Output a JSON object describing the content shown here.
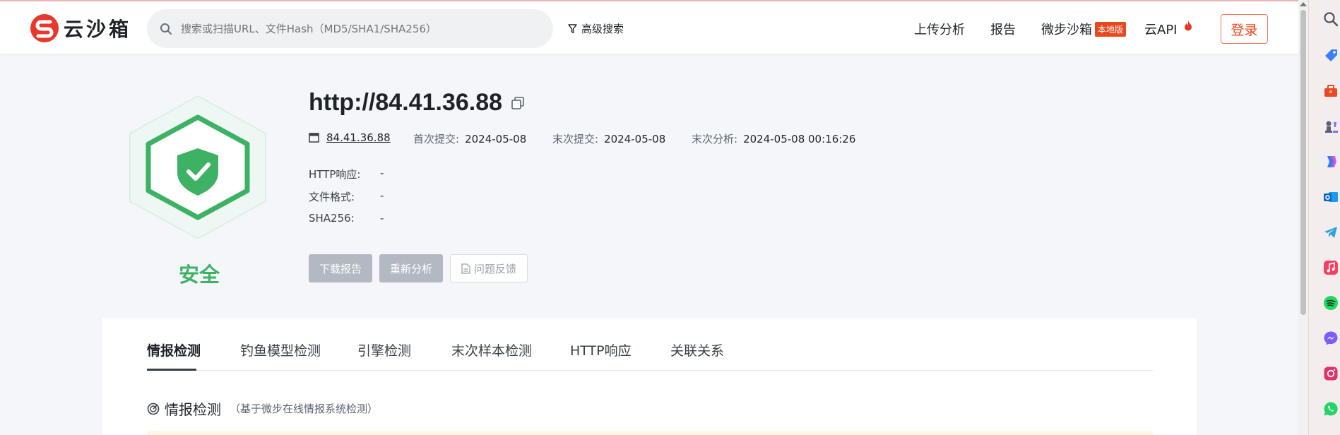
{
  "header": {
    "logo_text": "云沙箱",
    "search_placeholder": "搜索或扫描URL、文件Hash（MD5/SHA1/SHA256）",
    "advanced_search": "高级搜索",
    "nav": {
      "upload": "上传分析",
      "report": "报告",
      "sandbox": "微步沙箱",
      "sandbox_badge": "本地版",
      "api": "云API"
    },
    "login": "登录"
  },
  "result": {
    "verdict": "安全",
    "verdict_color": "#3db264",
    "title": "http://84.41.36.88",
    "host": "84.41.36.88",
    "first_submit_label": "首次提交:",
    "first_submit": "2024-05-08",
    "last_submit_label": "末次提交:",
    "last_submit": "2024-05-08",
    "last_analysis_label": "末次分析:",
    "last_analysis": "2024-05-08 00:16:26",
    "rows": [
      {
        "label": "HTTP响应:",
        "value": "-"
      },
      {
        "label": "文件格式:",
        "value": "-"
      },
      {
        "label": "SHA256:",
        "value": "-"
      }
    ],
    "buttons": {
      "download": "下载报告",
      "reanalyze": "重新分析",
      "feedback": "问题反馈"
    }
  },
  "tabs": [
    "情报检测",
    "钓鱼模型检测",
    "引擎检测",
    "末次样本检测",
    "HTTP响应",
    "关联关系"
  ],
  "active_tab": "情报检测",
  "section": {
    "title": "情报检测",
    "subtitle": "（基于微步在线情报系统检测）"
  },
  "dock_icons": [
    "search-icon",
    "tag-icon",
    "toolbox-icon",
    "chess-icon",
    "copilot-icon",
    "outlook-icon",
    "telegram-icon",
    "music-icon",
    "spotify-icon",
    "messenger-icon",
    "instagram-icon",
    "whatsapp-icon"
  ]
}
